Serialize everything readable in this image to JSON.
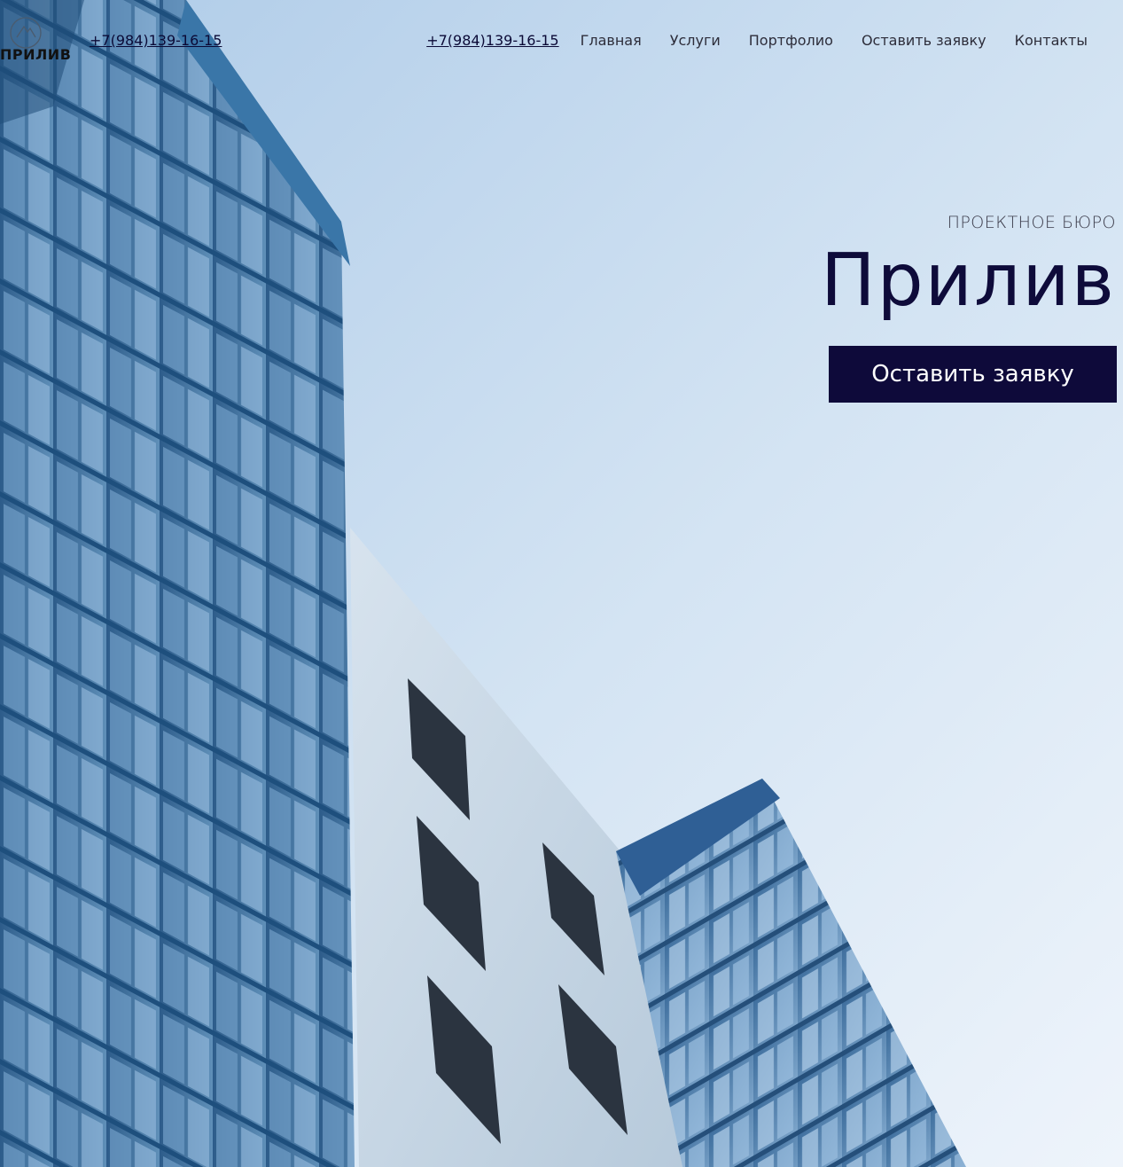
{
  "brand": {
    "logo_text": "ПРИЛИВ"
  },
  "header": {
    "phone_left": "+7(984)139-16-15",
    "nav": {
      "phone": "+7(984)139-16-15",
      "items": [
        "Главная",
        "Услуги",
        "Портфолио",
        "Оставить заявку",
        "Контакты"
      ]
    }
  },
  "hero": {
    "subtitle": "ПРОЕКТНОЕ БЮРО",
    "title": "Прилив",
    "cta_label": "Оставить заявку"
  },
  "colors": {
    "accent": "#0e0a3a",
    "sky": "#cfe0f1",
    "glass": "#2f5f8f"
  },
  "icons": {
    "logo": "mountain-circle-icon"
  }
}
